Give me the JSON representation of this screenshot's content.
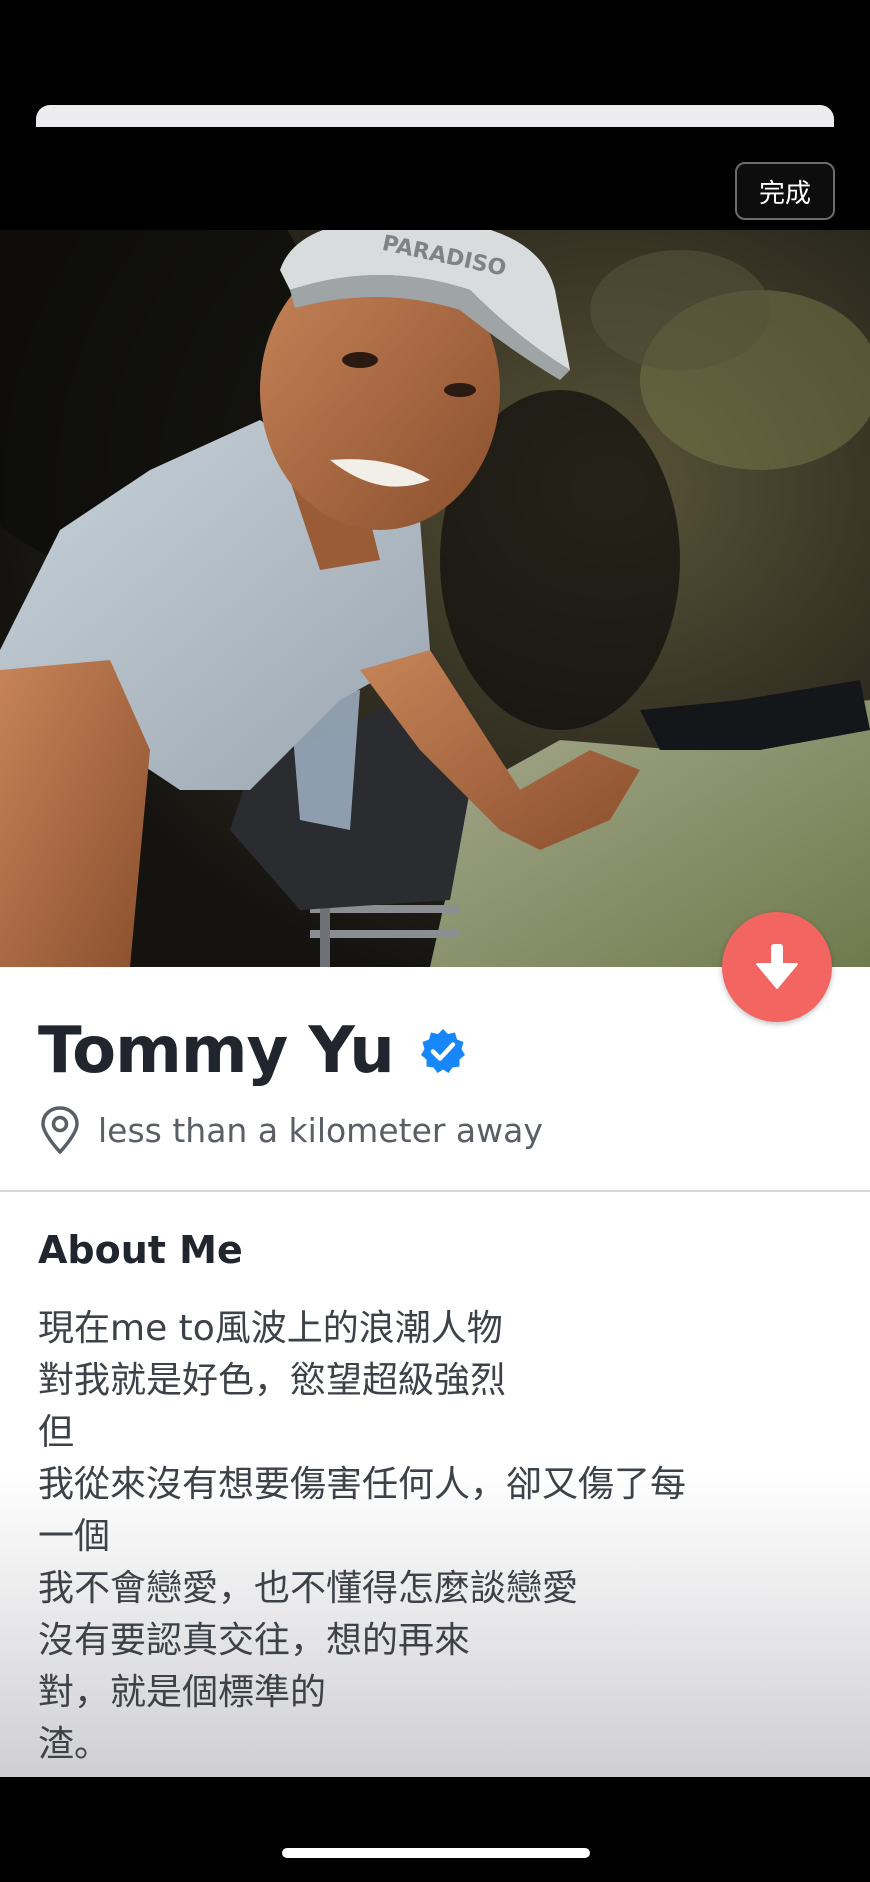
{
  "header": {
    "done_label": "完成"
  },
  "profile": {
    "name": "Tommy Yu",
    "verified": true,
    "distance": "less than a kilometer away",
    "photo_cap_text": "PARADISO"
  },
  "about": {
    "title": "About Me",
    "body": "現在me to風波上的浪潮人物\n對我就是好色，慾望超級強烈\n但\n我從來沒有想要傷害任何人，卻又傷了每\n一個\n我不會戀愛，也不懂得怎麼談戀愛\n沒有要認真交往，想的再來\n對，就是個標準的\n渣。"
  },
  "icons": {
    "fab": "arrow-down-icon",
    "verified": "verified-check-icon",
    "location": "location-pin-icon"
  },
  "colors": {
    "accent": "#f26560",
    "verified_blue": "#1786f8",
    "name_text": "#21262e",
    "body_text": "#3d4148"
  }
}
